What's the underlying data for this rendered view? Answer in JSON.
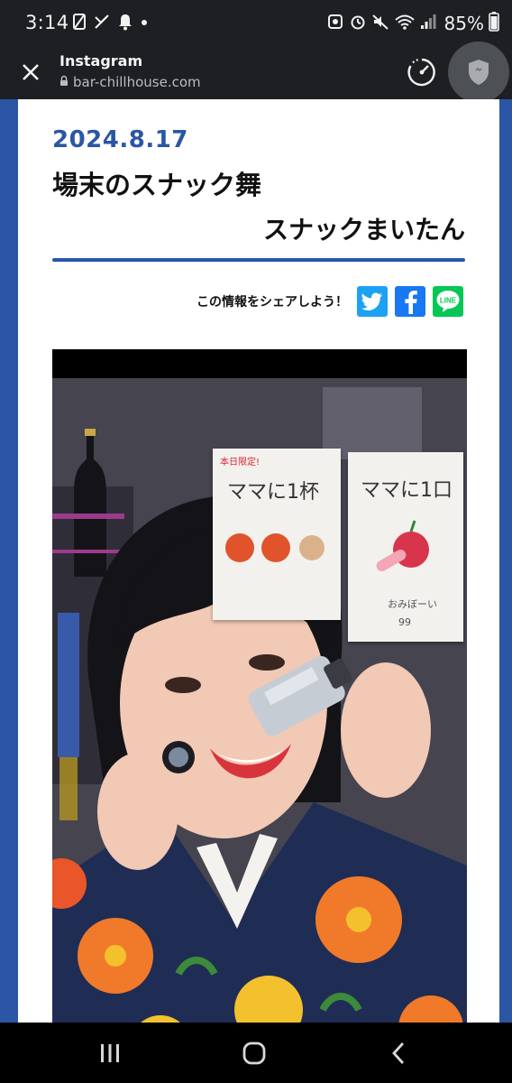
{
  "status_bar": {
    "time": "3:14",
    "battery": "85%",
    "icons_left": [
      "photo-icon",
      "missed-call-icon",
      "notification-bell-icon",
      "dot-icon"
    ],
    "icons_right": [
      "screenshot-icon",
      "alarm-icon",
      "mute-icon",
      "wifi-icon",
      "signal-icon",
      "battery-icon"
    ]
  },
  "toolbar": {
    "title": "Instagram",
    "url": "bar-chillhouse.com",
    "close_icon": "close-icon",
    "lock_icon": "lock-icon",
    "speed_icon": "speedometer-icon",
    "shield_icon": "shield-icon"
  },
  "post": {
    "date": "2024.8.17",
    "title": "場末のスナック舞",
    "author": "スナックまいたん"
  },
  "share": {
    "label": "この情報をシェアしよう！",
    "buttons": [
      {
        "name": "twitter",
        "icon": "twitter-icon",
        "color": "#1da1f2"
      },
      {
        "name": "facebook",
        "icon": "facebook-icon",
        "color": "#1877f2"
      },
      {
        "name": "line",
        "icon": "line-icon",
        "text": "LINE",
        "color": "#06c755"
      }
    ]
  },
  "media": {
    "menu_card_1": {
      "tag": "本日限定!",
      "title": "ママに1杯"
    },
    "menu_card_2": {
      "title": "ママに1口",
      "sub": "おみぼーい",
      "price": "99"
    }
  },
  "nav": {
    "recents_icon": "recents-icon",
    "home_icon": "home-icon",
    "back_icon": "back-icon"
  },
  "colors": {
    "accent": "#2a56a5",
    "status_bg": "#1d1f22"
  }
}
